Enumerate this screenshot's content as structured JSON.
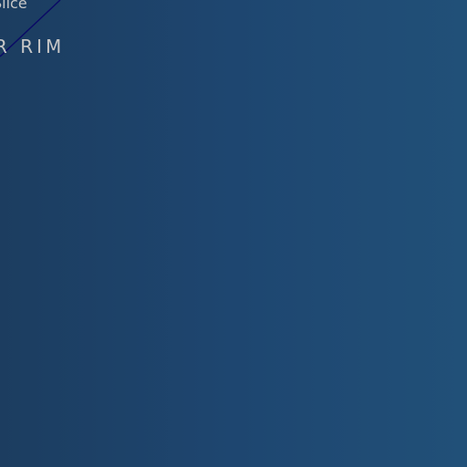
{
  "overlay": {
    "slice_label": "Slice",
    "rim_label": "R RIM"
  },
  "colors": {
    "background_left": "#1c3d60",
    "background_right": "#215078",
    "text": "#c8c8c8",
    "line": "#0a0a66"
  }
}
